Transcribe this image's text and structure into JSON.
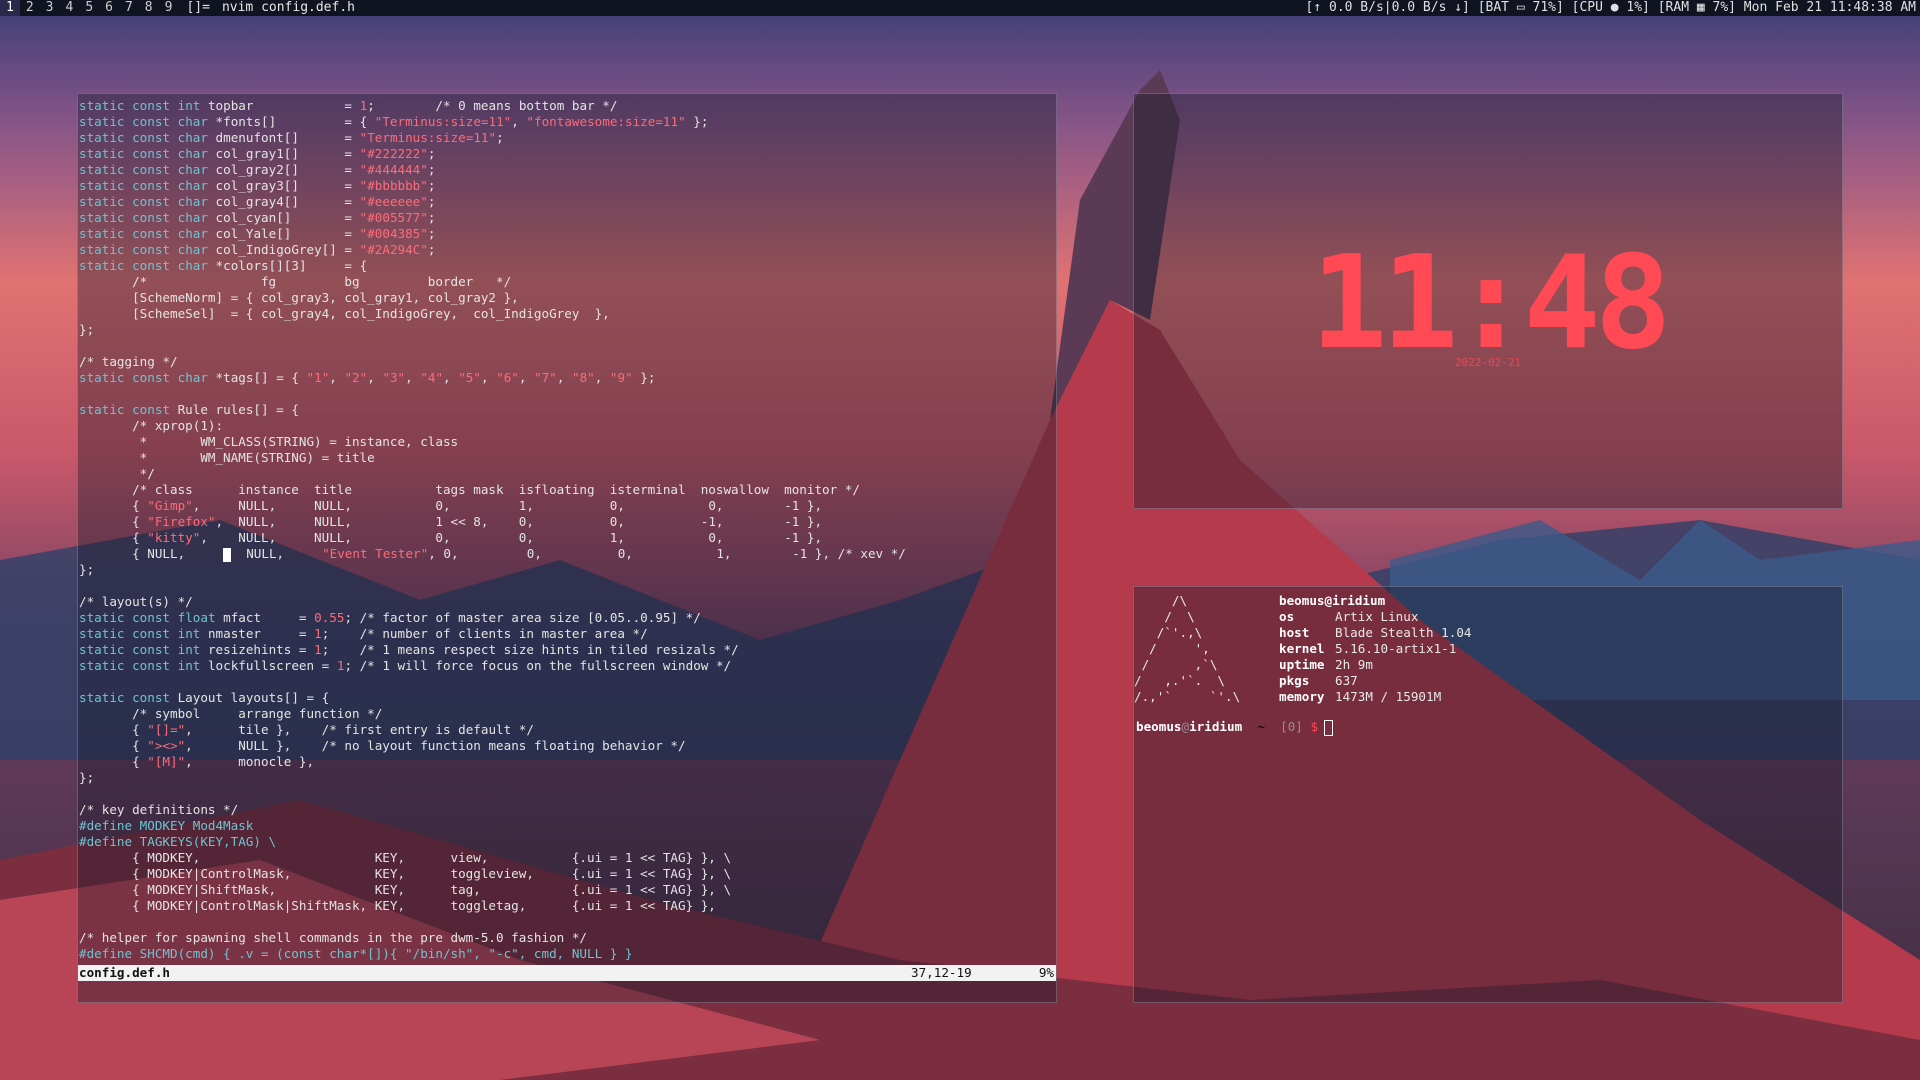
{
  "topbar": {
    "tags": [
      {
        "label": "1",
        "selected": true
      },
      {
        "label": "2",
        "selected": false
      },
      {
        "label": "3",
        "selected": false
      },
      {
        "label": "4",
        "selected": false
      },
      {
        "label": "5",
        "selected": false
      },
      {
        "label": "6",
        "selected": false
      },
      {
        "label": "7",
        "selected": false
      },
      {
        "label": "8",
        "selected": false
      },
      {
        "label": "9",
        "selected": false
      }
    ],
    "layout_symbol": "[]=",
    "window_title": "nvim config.def.h",
    "status": "[↑ 0.0 B/s|0.0 B/s ↓] [BAT ▭ 71%] [CPU ● 1%] [RAM ▦ 7%] Mon Feb 21 11:48:38 AM"
  },
  "editor": {
    "lines": [
      "static const int topbar            = 1;        /* 0 means bottom bar */",
      "static const char *fonts[]         = { \"Terminus:size=11\", \"fontawesome:size=11\" };",
      "static const char dmenufont[]      = \"Terminus:size=11\";",
      "static const char col_gray1[]      = \"#222222\";",
      "static const char col_gray2[]      = \"#444444\";",
      "static const char col_gray3[]      = \"#bbbbbb\";",
      "static const char col_gray4[]      = \"#eeeeee\";",
      "static const char col_cyan[]       = \"#005577\";",
      "static const char col_Yale[]       = \"#004385\";",
      "static const char col_IndigoGrey[] = \"#2A294C\";",
      "static const char *colors[][3]     = {",
      "\t/*               fg         bg         border   */",
      "\t[SchemeNorm] = { col_gray3, col_gray1, col_gray2 },",
      "\t[SchemeSel]  = { col_gray4, col_IndigoGrey,  col_IndigoGrey  },",
      "};",
      "",
      "/* tagging */",
      "static const char *tags[] = { \"1\", \"2\", \"3\", \"4\", \"5\", \"6\", \"7\", \"8\", \"9\" };",
      "",
      "static const Rule rules[] = {",
      "\t/* xprop(1):",
      "\t *\tWM_CLASS(STRING) = instance, class",
      "\t *\tWM_NAME(STRING) = title",
      "\t */",
      "\t/* class      instance  title           tags mask  isfloating  isterminal  noswallow  monitor */",
      "\t{ \"Gimp\",     NULL,     NULL,           0,         1,          0,           0,        -1 },",
      "\t{ \"Firefox\",  NULL,     NULL,           1 << 8,    0,          0,          -1,        -1 },",
      "\t{ \"kitty\",    NULL,     NULL,           0,         0,          1,           0,        -1 },",
      "\t{ NULL,     \u0000  NULL,     \"Event Tester\", 0,         0,          0,           1,        -1 }, /* xev */",
      "};",
      "",
      "/* layout(s) */",
      "static const float mfact     = 0.55; /* factor of master area size [0.05..0.95] */",
      "static const int nmaster     = 1;    /* number of clients in master area */",
      "static const int resizehints = 1;    /* 1 means respect size hints in tiled resizals */",
      "static const int lockfullscreen = 1; /* 1 will force focus on the fullscreen window */",
      "",
      "static const Layout layouts[] = {",
      "\t/* symbol     arrange function */",
      "\t{ \"[]=\",      tile },    /* first entry is default */",
      "\t{ \"><>\",      NULL },    /* no layout function means floating behavior */",
      "\t{ \"[M]\",      monocle },",
      "};",
      "",
      "/* key definitions */",
      "#define MODKEY Mod4Mask",
      "#define TAGKEYS(KEY,TAG) \\",
      "\t{ MODKEY,                       KEY,      view,           {.ui = 1 << TAG} }, \\",
      "\t{ MODKEY|ControlMask,           KEY,      toggleview,     {.ui = 1 << TAG} }, \\",
      "\t{ MODKEY|ShiftMask,             KEY,      tag,            {.ui = 1 << TAG} }, \\",
      "\t{ MODKEY|ControlMask|ShiftMask, KEY,      toggletag,      {.ui = 1 << TAG} },",
      "",
      "/* helper for spawning shell commands in the pre dwm-5.0 fashion */",
      "#define SHCMD(cmd) { .v = (const char*[]){ \"/bin/sh\", \"-c\", cmd, NULL } }"
    ],
    "status_file": "config.def.h",
    "status_pos": "37,12-19",
    "status_pct": "9%"
  },
  "clock": {
    "time": "11:48",
    "date": "2022-02-21"
  },
  "terminal": {
    "art": "     /\\\n    /  \\\n   /`'.,\\\n  /     ',\n /      ,`\\\n/   ,.'`.  \\\n/.,'`     `'.\\",
    "user_host": "beomus@iridium",
    "info": [
      {
        "key": "os",
        "value": "Artix Linux"
      },
      {
        "key": "host",
        "value": "Blade Stealth 1.04"
      },
      {
        "key": "kernel",
        "value": "5.16.10-artix1-1"
      },
      {
        "key": "uptime",
        "value": "2h 9m"
      },
      {
        "key": "pkgs",
        "value": "637"
      },
      {
        "key": "memory",
        "value": "1473M / 15901M"
      }
    ],
    "prompt_user": "beomus",
    "prompt_at": "@",
    "prompt_host": "iridium",
    "prompt_dir": "~",
    "prompt_jobs": "[0]",
    "prompt_symbol": "$"
  },
  "colors": {
    "accent": "#ff4a55",
    "bar_bg": "#101320",
    "selected_tag": "#2A294C"
  }
}
